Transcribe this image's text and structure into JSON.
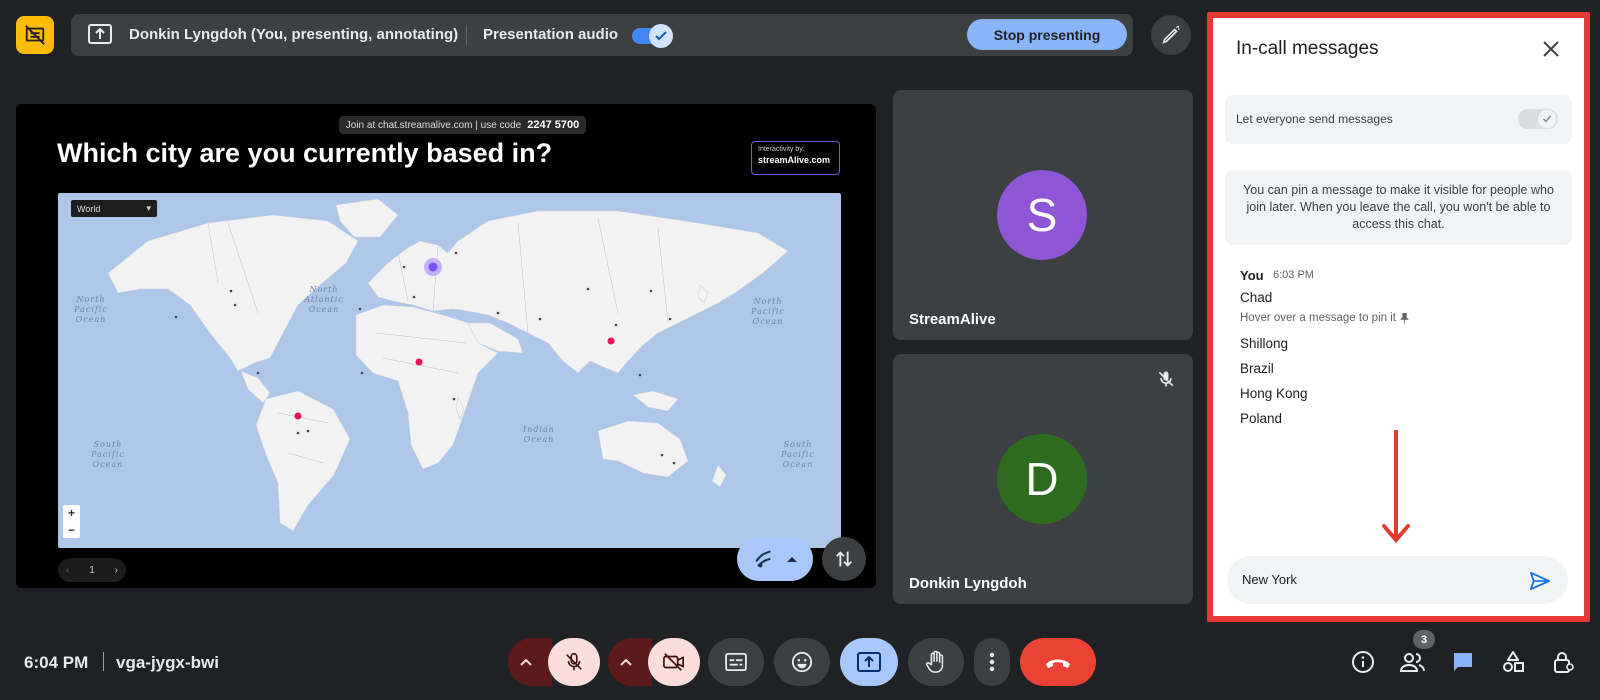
{
  "topbar": {
    "presenter_text": "Donkin Lyngdoh (You, presenting, annotating)",
    "audio_label": "Presentation audio",
    "audio_enabled": true,
    "stop_label": "Stop presenting"
  },
  "slide": {
    "join_text": "Join at chat.streamalive.com | use code",
    "join_code": "2247 5700",
    "question": "Which city are you currently based in?",
    "brand_small": "Interactivity by:",
    "brand_name": "streamAlive.com",
    "region_select": "World",
    "oceans": [
      {
        "name": "North Pacific Ocean"
      },
      {
        "name": "North Atlantic Ocean"
      },
      {
        "name": "North Pacific Ocean"
      },
      {
        "name": "South Pacific Ocean"
      },
      {
        "name": "Indian Ocean"
      },
      {
        "name": "South Pacific Ocean"
      }
    ],
    "zoom_in": "+",
    "zoom_out": "−",
    "page": "1"
  },
  "participants": [
    {
      "initial": "S",
      "name": "StreamAlive",
      "color": "#8e55d5"
    },
    {
      "initial": "D",
      "name": "Donkin Lyngdoh",
      "color": "#2d6b1f",
      "muted": true
    }
  ],
  "chat": {
    "title": "In-call messages",
    "setting_label": "Let everyone send messages",
    "setting_on": true,
    "info": "You can pin a message to make it visible for people who join later. When you leave the call, you won't be able to access this chat.",
    "sender": "You",
    "time": "6:03 PM",
    "pin_hint": "Hover over a message to pin it",
    "messages": [
      "Chad",
      "Shillong",
      "Brazil",
      "Hong Kong",
      "Poland"
    ],
    "input_value": "New York"
  },
  "bottombar": {
    "clock": "6:04 PM",
    "meeting_code": "vga-jygx-bwi",
    "people_count": "3"
  },
  "colors": {
    "accent": "#8ab4f8",
    "hangup": "#ea4335",
    "highlight_border": "#e53935",
    "map_pin": "#e8125c"
  }
}
